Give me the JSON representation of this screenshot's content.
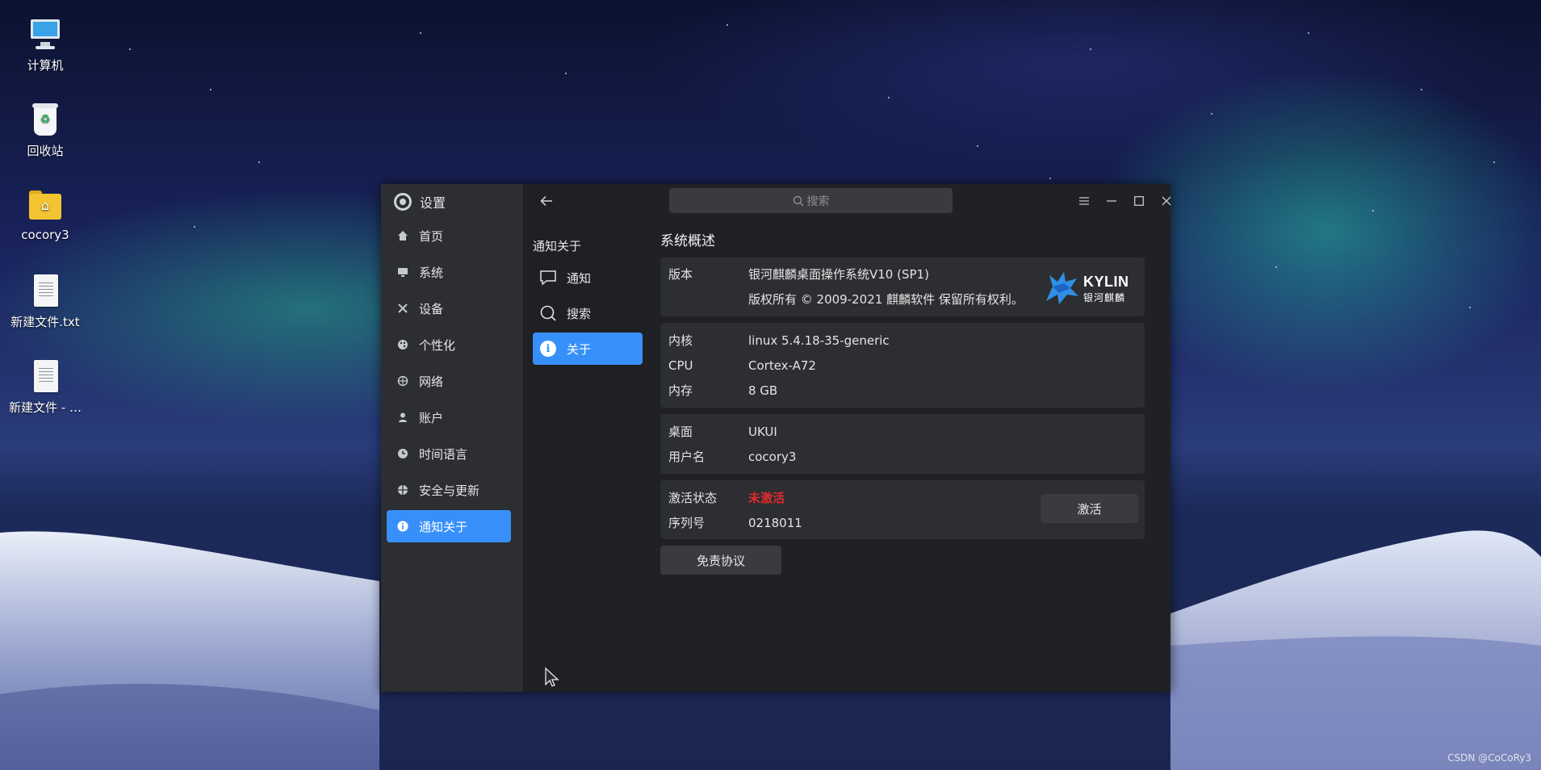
{
  "desktop": {
    "icons": [
      {
        "label": "计算机",
        "icon": "computer-icon"
      },
      {
        "label": "回收站",
        "icon": "trash-icon"
      },
      {
        "label": "cocory3",
        "icon": "home-folder-icon"
      },
      {
        "label": "新建文件.txt",
        "icon": "text-file-icon"
      },
      {
        "label": "新建文件 - …",
        "icon": "text-file-icon"
      }
    ]
  },
  "window": {
    "title": "设置",
    "search_placeholder": "搜索",
    "nav": [
      {
        "label": "首页",
        "icon": "home-icon"
      },
      {
        "label": "系统",
        "icon": "monitor-icon"
      },
      {
        "label": "设备",
        "icon": "tools-icon"
      },
      {
        "label": "个性化",
        "icon": "palette-icon"
      },
      {
        "label": "网络",
        "icon": "globe-icon"
      },
      {
        "label": "账户",
        "icon": "user-icon"
      },
      {
        "label": "时间语言",
        "icon": "clock-icon"
      },
      {
        "label": "安全与更新",
        "icon": "shield-icon"
      },
      {
        "label": "通知关于",
        "icon": "info-icon",
        "active": true
      }
    ],
    "subpanel": {
      "heading": "通知关于",
      "items": [
        {
          "label": "通知",
          "icon": "chat-icon"
        },
        {
          "label": "搜索",
          "icon": "search-icon"
        },
        {
          "label": "关于",
          "icon": "info-icon",
          "active": true
        }
      ]
    },
    "about": {
      "section_title": "系统概述",
      "version": {
        "key": "版本",
        "value": "银河麒麟桌面操作系统V10 (SP1)",
        "copyright": "版权所有 © 2009-2021 麒麟软件 保留所有权利。"
      },
      "logo": {
        "word": "KYLIN",
        "cn": "银河麒麟"
      },
      "hardware": [
        {
          "key": "内核",
          "value": "linux 5.4.18-35-generic"
        },
        {
          "key": "CPU",
          "value": "Cortex-A72"
        },
        {
          "key": "内存",
          "value": "8 GB"
        }
      ],
      "desktop_info": [
        {
          "key": "桌面",
          "value": "UKUI"
        },
        {
          "key": "用户名",
          "value": "cocory3"
        }
      ],
      "activation": {
        "status_key": "激活状态",
        "status_value": "未激活",
        "status_color": "#e32b2b",
        "serial_key": "序列号",
        "serial_value": "0218011",
        "activate_button": "激活"
      },
      "disclaimer_button": "免责协议"
    }
  },
  "watermark": "CSDN @CoCoRy3",
  "colors": {
    "accent": "#3790fa",
    "window_bg": "#202124",
    "sidebar_bg": "#2c2e31"
  }
}
